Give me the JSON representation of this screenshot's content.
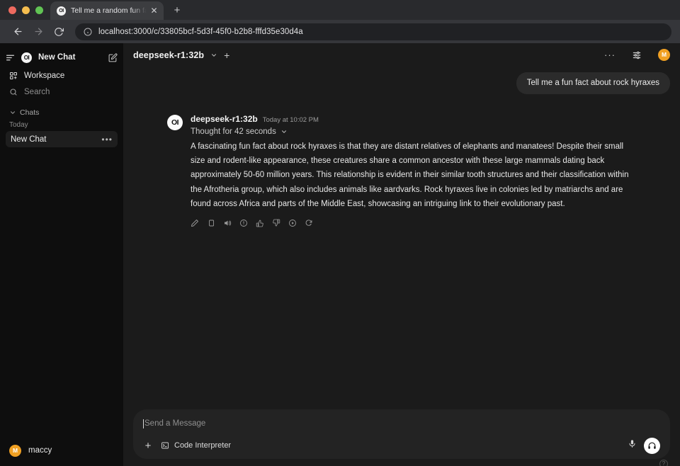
{
  "browser": {
    "tab": {
      "title": "Tell me a random fun fact abo",
      "favicon_label": "OI",
      "favicon_icon": "openwebui-logo-icon",
      "close_label": "✕"
    },
    "new_tab_label": "+",
    "nav": {
      "back_icon": "arrow-left-icon",
      "forward_icon": "arrow-right-icon",
      "reload_icon": "reload-icon",
      "info_icon": "site-info-icon"
    },
    "url": "localhost:3000/c/33805bcf-5d3f-45f0-b2b8-fffd35e30d4a"
  },
  "sidebar": {
    "menu_icon": "sidebar-toggle-icon",
    "logo_label": "OI",
    "new_chat_label": "New Chat",
    "edit_icon": "new-chat-pencil-icon",
    "workspace": {
      "icon": "workspace-grid-icon",
      "label": "Workspace"
    },
    "search": {
      "icon": "search-icon",
      "label": "Search"
    },
    "chats_section": {
      "icon": "chevron-down-icon",
      "label": "Chats"
    },
    "day_label": "Today",
    "chat_item": {
      "label": "New Chat",
      "menu_label": "•••"
    },
    "user": {
      "initial": "M",
      "name": "maccy"
    }
  },
  "header": {
    "model": "deepseek-r1:32b",
    "model_chevron_icon": "chevron-down-icon",
    "add_model_label": "+",
    "more_label": "···",
    "controls_icon": "sliders-icon",
    "avatar_initial": "M"
  },
  "conversation": {
    "user_message": "Tell me a fun fact about rock hyraxes",
    "assistant": {
      "avatar_label": "OI",
      "name": "deepseek-r1:32b",
      "timestamp": "Today at 10:02 PM",
      "thought_label": "Thought for 42 seconds",
      "thought_chevron_icon": "chevron-down-icon",
      "text": "A fascinating fun fact about rock hyraxes is that they are distant relatives of elephants and manatees! Despite their small size and rodent-like appearance, these creatures share a common ancestor with these large mammals dating back approximately 50-60 million years. This relationship is evident in their similar tooth structures and their classification within the Afrotheria group, which also includes animals like aardvarks. Rock hyraxes live in colonies led by matriarchs and are found across Africa and parts of the Middle East, showcasing an intriguing link to their evolutionary past.",
      "actions": [
        {
          "icon": "edit-pencil-icon",
          "name": "edit"
        },
        {
          "icon": "copy-icon",
          "name": "copy"
        },
        {
          "icon": "speaker-icon",
          "name": "read-aloud"
        },
        {
          "icon": "info-icon",
          "name": "info"
        },
        {
          "icon": "thumbs-up-icon",
          "name": "good-response"
        },
        {
          "icon": "thumbs-down-icon",
          "name": "bad-response"
        },
        {
          "icon": "continue-icon",
          "name": "continue-response"
        },
        {
          "icon": "regenerate-icon",
          "name": "regenerate"
        }
      ]
    }
  },
  "composer": {
    "placeholder": "Send a Message",
    "plus_label": "+",
    "tool": {
      "icon": "code-interpreter-icon",
      "label": "Code Interpreter"
    },
    "mic_icon": "microphone-icon",
    "call_icon": "headphones-icon",
    "help_label": "?"
  },
  "colors": {
    "accent_orange": "#f0a023",
    "sidebar_bg": "#0e0e0e",
    "main_bg": "#1b1b1b",
    "composer_bg": "#232323",
    "user_bubble_bg": "#2b2b2b"
  }
}
